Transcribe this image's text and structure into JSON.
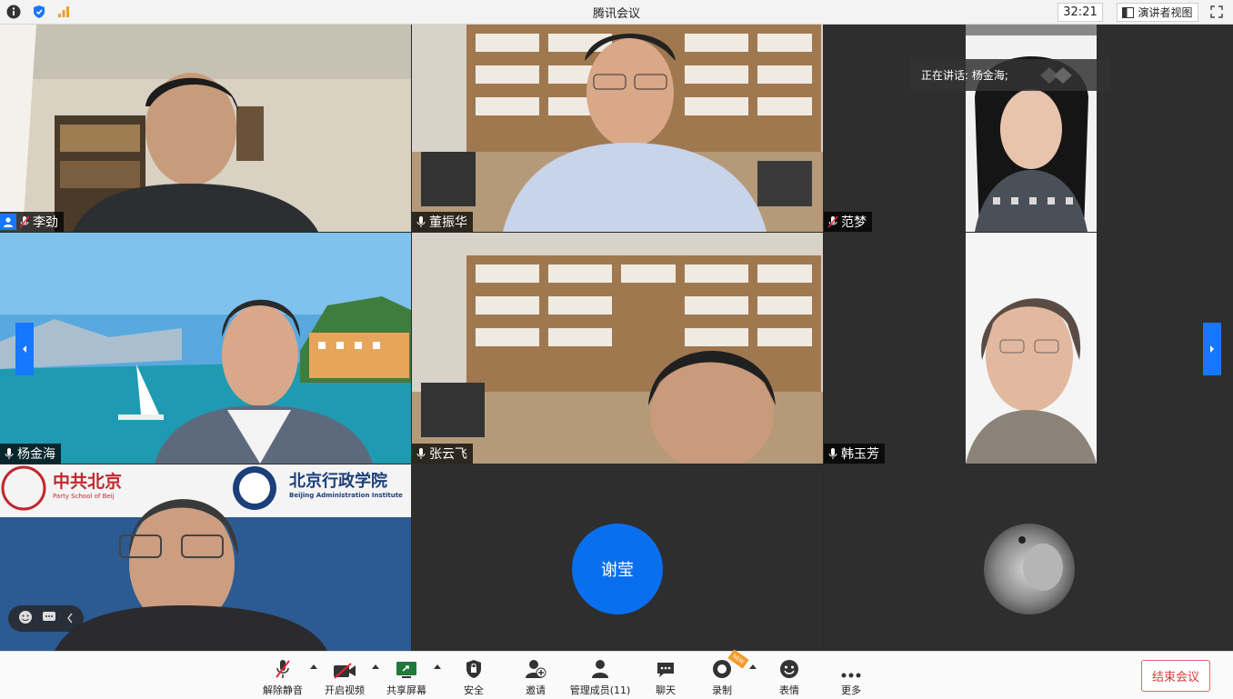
{
  "window": {
    "title": "腾讯会议",
    "timer": "32:21",
    "view_label": "演讲者视图",
    "info_icon": "info-icon",
    "security_icon": "shield-icon",
    "signal_icon": "signal-bars-icon"
  },
  "speaking_banner": "正在讲话: 杨金海;",
  "participants": [
    {
      "name": "李劲",
      "mic": "muted"
    },
    {
      "name": "董振华",
      "mic": "on"
    },
    {
      "name": "范梦",
      "mic": "muted"
    },
    {
      "name": "杨金海",
      "mic": "on"
    },
    {
      "name": "张云飞",
      "mic": "on"
    },
    {
      "name": "韩玉芳",
      "mic": "on"
    },
    {
      "name": "",
      "mic": "none"
    },
    {
      "name": "谢莹",
      "mic": "none"
    },
    {
      "name": "",
      "mic": "none"
    }
  ],
  "background_texts": {
    "org_cn": "北京行政学院",
    "org_en": "Beijing Administration Institute",
    "party_cn": "中共北京",
    "party_en": "Party School of Beij"
  },
  "toolbar": {
    "unmute": "解除静音",
    "start_video": "开启视频",
    "share_screen": "共享屏幕",
    "security": "安全",
    "invite": "邀请",
    "manage_members": "管理成员(11)",
    "chat": "聊天",
    "record": "录制",
    "record_badge": "NEW",
    "reactions": "表情",
    "more": "更多",
    "end_meeting": "结束会议"
  },
  "colors": {
    "accent_blue": "#1677ff",
    "avatar_blue": "#0a6fef",
    "end_red": "#d43a3a"
  }
}
